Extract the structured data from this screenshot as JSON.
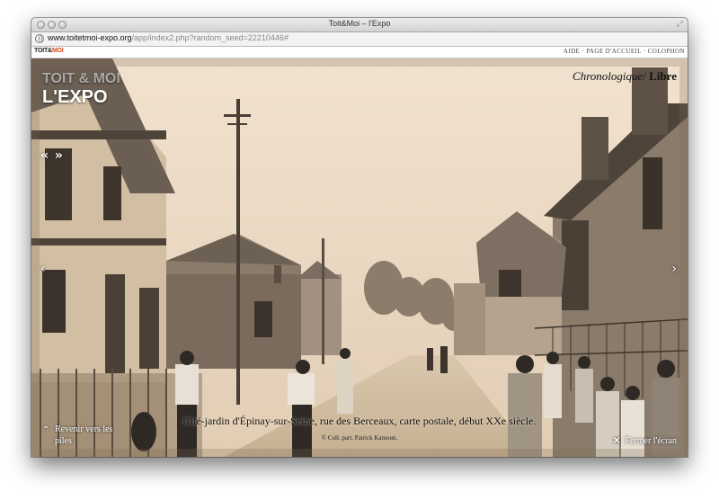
{
  "window": {
    "title": "Toit&Moi – l'Expo"
  },
  "browser": {
    "url_host": "www.toitetmoi-expo.org",
    "url_path": "/app/index2.php?random_seed=22210446#"
  },
  "site": {
    "logo_part1": "TOIT&",
    "logo_part2": "MOI",
    "nav": [
      "AIDE",
      "PAGE D'ACCUEIL",
      "COLOPHON"
    ],
    "nav_separator": " · "
  },
  "expo": {
    "title_small": "TOIT & MOI",
    "title_big": "L'EXPO",
    "mode_italic": "Chronologique",
    "mode_sep": "/ ",
    "mode_bold": "Libre",
    "prev_next": "« »",
    "arrow_left": "‹",
    "arrow_right": "›"
  },
  "photo": {
    "caption": "Cité-jardin d'Épinay-sur-Seine, rue des Berceaux, carte postale, début XXe siècle.",
    "credit": "© Coll. part. Patrick Kamoun."
  },
  "controls": {
    "back_label": "Revenir vers les piles",
    "back_icon": "chevron-up-icon",
    "close_label": "Fermer l'écran",
    "close_icon": "close-icon"
  },
  "colors": {
    "logo_accent": "#d94b1d",
    "photo_tone": "#e6d2ba"
  }
}
